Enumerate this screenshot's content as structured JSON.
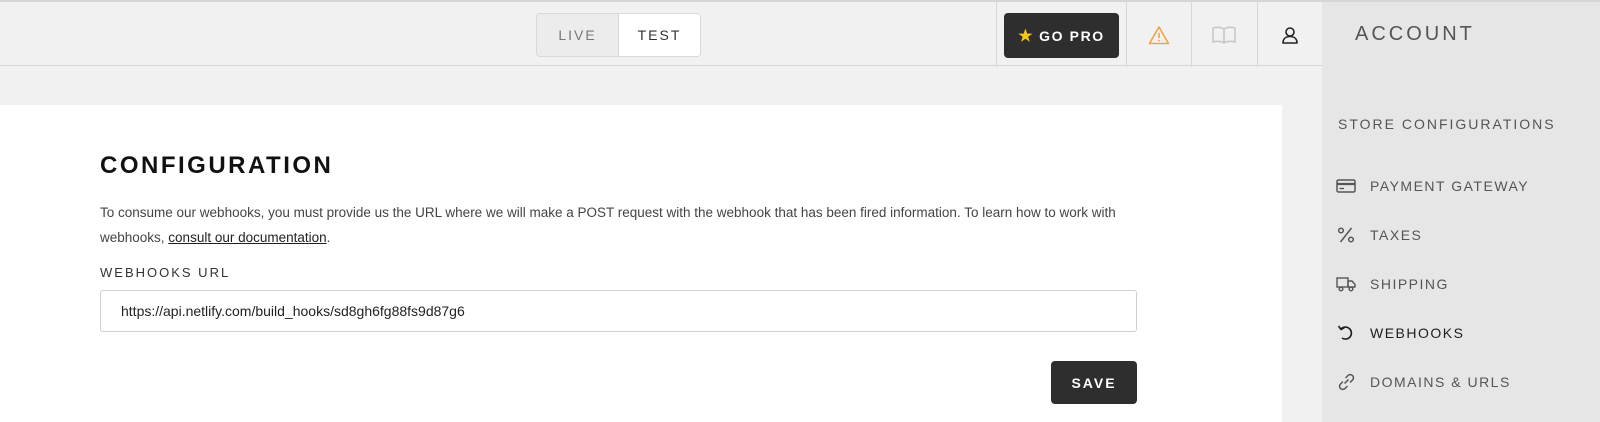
{
  "topbar": {
    "mode_live": "LIVE",
    "mode_test": "TEST",
    "active_mode": "TEST",
    "go_pro": "GO PRO",
    "account": "ACCOUNT"
  },
  "sidebar": {
    "section": "STORE CONFIGURATIONS",
    "items": [
      {
        "label": "PAYMENT GATEWAY",
        "icon": "credit-card-icon"
      },
      {
        "label": "TAXES",
        "icon": "percent-icon"
      },
      {
        "label": "SHIPPING",
        "icon": "truck-icon"
      },
      {
        "label": "WEBHOOKS",
        "icon": "webhook-return-icon",
        "active": true
      },
      {
        "label": "DOMAINS & URLS",
        "icon": "link-icon"
      }
    ]
  },
  "main": {
    "title": "CONFIGURATION",
    "description": "To consume our webhooks, you must provide us the URL where we will make a POST request with the webhook that has been fired information. To learn how to work with webhooks, ",
    "doc_link": "consult our documentation",
    "description_end": ".",
    "field_label": "WEBHOOKS URL",
    "webhook_url": "https://api.netlify.com/build_hooks/sd8gh6fg88fs9d87g6",
    "save": "SAVE"
  },
  "colors": {
    "dark_button": "#2e2e2e",
    "warning": "#f0a443",
    "star": "#f5c518"
  }
}
